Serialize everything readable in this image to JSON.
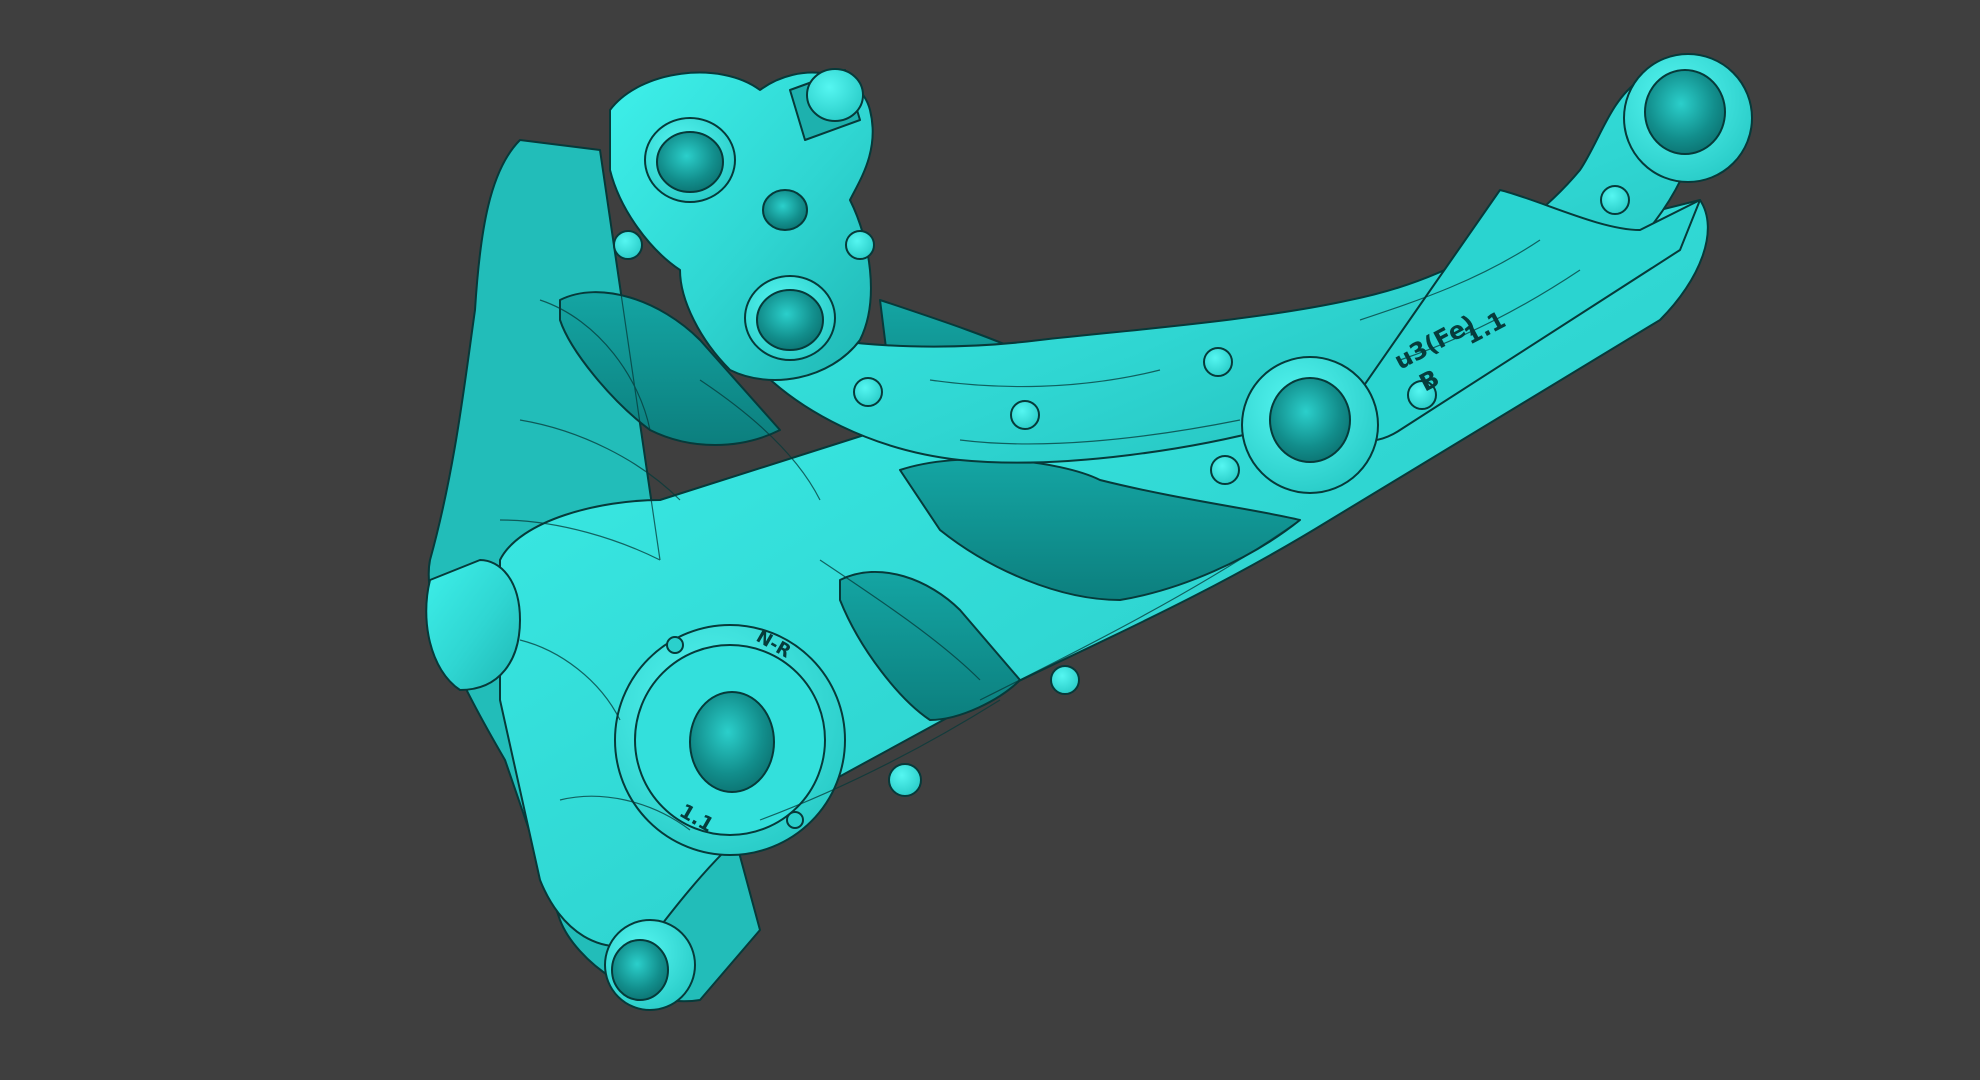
{
  "viewport": {
    "background_color": "#3f3f3f",
    "model": {
      "name": "cast bracket part",
      "surface_color": "#33e4e0",
      "shade_color": "#1aa8a6",
      "dark_shade_color": "#0e7f7e",
      "edge_color": "#063a3a"
    }
  },
  "engravings": {
    "material": "u3(Fe)",
    "grade": "B",
    "revision": "1.1",
    "boss_revision": "1.1",
    "boss_mark": "N-R"
  }
}
